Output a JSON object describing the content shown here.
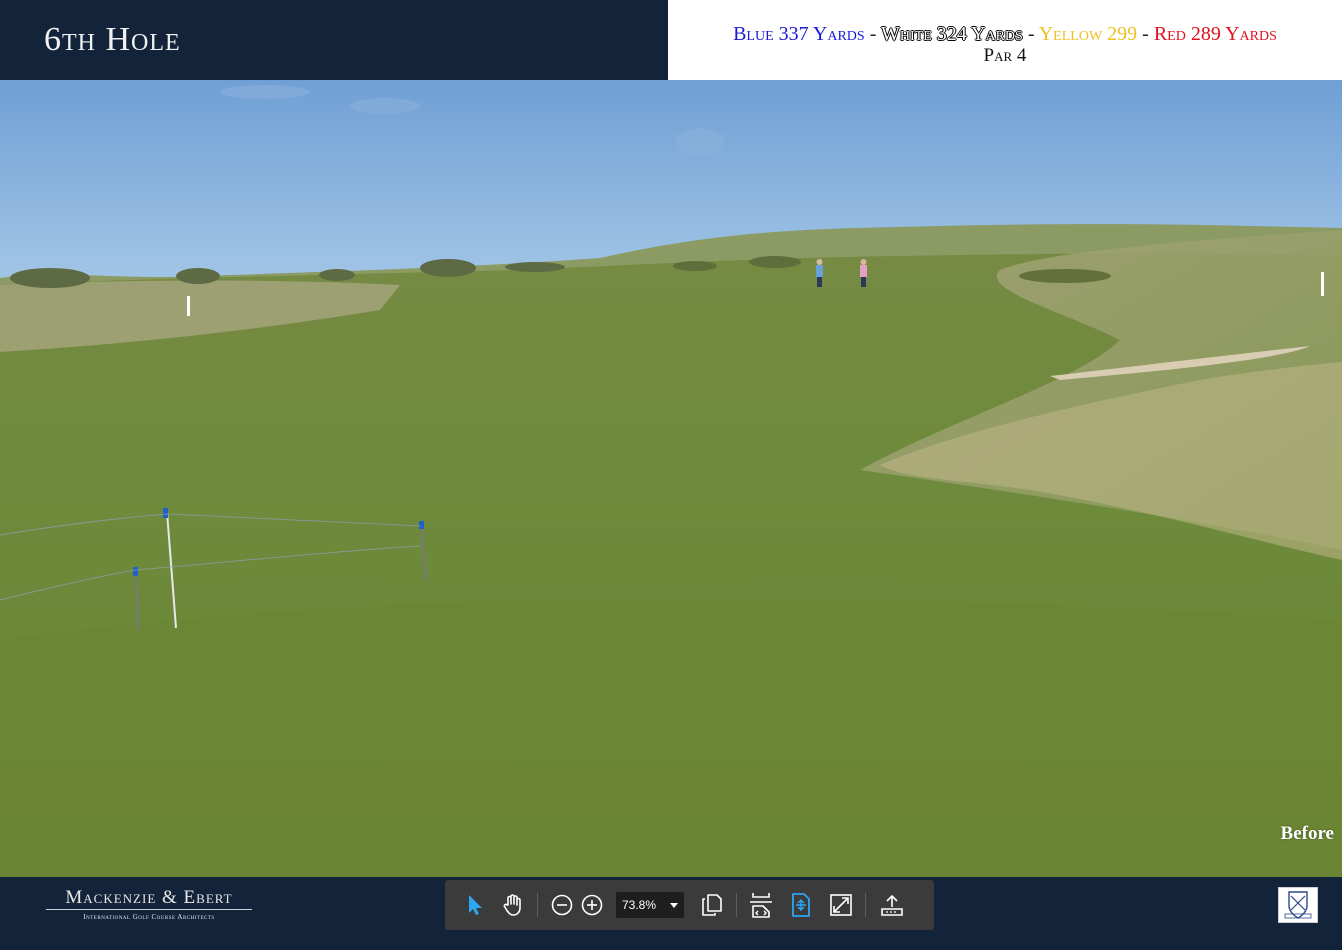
{
  "header": {
    "hole_title": "6th Hole",
    "tees": [
      {
        "label": "Blue 337 Yards",
        "color": "#1a1ad6"
      },
      {
        "label": "White 324 Yards",
        "color": "#ffffff"
      },
      {
        "label": "Yellow 299",
        "color": "#f0c020"
      },
      {
        "label": "Red 289 Yards",
        "color": "#e01020"
      }
    ],
    "separator": " - ",
    "par": "Par 4"
  },
  "photo": {
    "caption": "Before"
  },
  "footer": {
    "logo_main": "Mackenzie & Ebert",
    "logo_sub": "International Golf Course Architects"
  },
  "toolbar": {
    "zoom_value": "73.8%",
    "icons": [
      "select-tool-icon",
      "hand-tool-icon",
      "zoom-out-icon",
      "zoom-in-icon",
      "zoom-dropdown-icon",
      "page-view-icon",
      "fit-width-icon",
      "fit-page-icon",
      "fullscreen-icon",
      "share-icon"
    ]
  },
  "colors": {
    "navy": "#13233a",
    "toolbar_bg": "#3b3b3b",
    "active_icon": "#2ea6f2"
  }
}
